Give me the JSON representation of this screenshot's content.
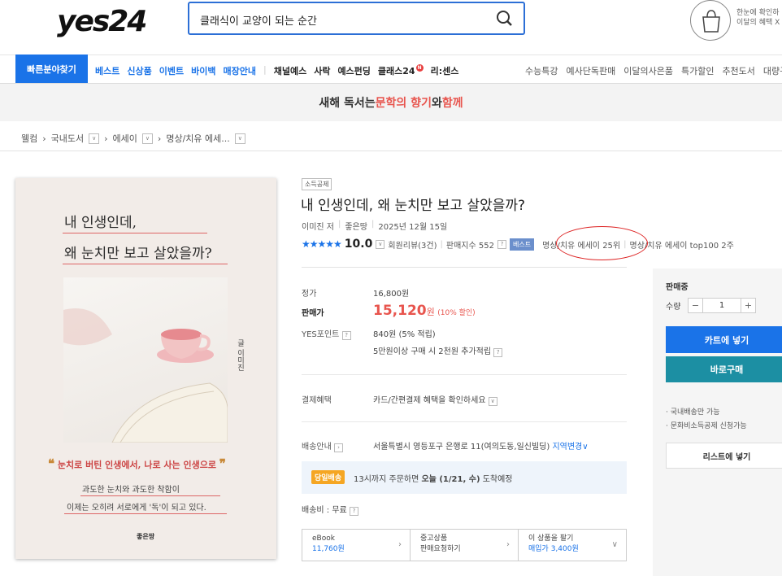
{
  "header": {
    "logo": "yes24",
    "search_value": "클래식이 교양이 되는 순간",
    "cart_note": "한눈에 확인하 이달의 혜택 X"
  },
  "nav": {
    "quick": "빠른분야찾기",
    "left_blue": [
      "베스트",
      "신상품",
      "이벤트",
      "바이백",
      "매장안내"
    ],
    "left_dark": [
      "채널예스",
      "사락",
      "예스펀딩",
      "클래스24",
      "리:센스"
    ],
    "badge": "N",
    "right": [
      "수능특강",
      "예사단독판매",
      "이달의사은품",
      "특가할인",
      "추천도서",
      "대량구"
    ]
  },
  "banner": {
    "prefix": "새해 독서는 ",
    "accent1": "문학의 향기",
    "mid": "와 ",
    "accent2": "함께"
  },
  "breadcrumb": [
    "웰컴",
    "국내도서",
    "에세이",
    "명상/치유 에세..."
  ],
  "cover": {
    "title1": "내 인생인데,",
    "title2": "왜 눈치만 보고 살았을까?",
    "author_vertical": "글 이미진",
    "quote": "눈치로 버틴 인생에서, 나로 사는 인생으로",
    "sub1": "과도한 눈치와 과도한 착함이",
    "sub2": "이제는 오히려 서로에게 '독'이 되고 있다.",
    "publisher": "좋은땅"
  },
  "product": {
    "tag": "소득공제",
    "title": "내 인생인데, 왜 눈치만 보고 살았을까?",
    "author": "이미진 저",
    "publisher": "좋은땅",
    "date": "2025년 12월 15일",
    "stars": "★★★★★",
    "score": "10.0",
    "reviews": "회원리뷰(3건)",
    "sales_index": "판매지수 552",
    "best_label": "베스트",
    "rank1": "명상/치유 에세이 25위",
    "rank2": "명상/치유 에세이 top100 2주"
  },
  "price": {
    "list_label": "정가",
    "list_value": "16,800원",
    "sale_label": "판매가",
    "sale_value": "15,120",
    "sale_unit": "원",
    "discount": "(10% 할인)",
    "points_label": "YES포인트",
    "points_value": "840원 (5% 적립)",
    "points_extra": "5만원이상 구매 시 2천원 추가적립"
  },
  "payment": {
    "label": "결제혜택",
    "value": "카드/간편결제 혜택을 확인하세요"
  },
  "delivery": {
    "label": "배송안내",
    "address": "서울특별시 영등포구 은행로 11(여의도동,일신빌딩)",
    "region_change": "지역변경",
    "today_badge": "당일배송",
    "today_text_pre": "13시까지 주문하면 ",
    "today_text_bold": "오늘 (1/21, 수)",
    "today_text_post": " 도착예정",
    "fee": "배송비 : 무료"
  },
  "bottom": {
    "ebook_label": "eBook",
    "ebook_price": "11,760원",
    "used_label": "중고상품",
    "used_action": "판매요청하기",
    "sell_label": "이 상품을 팔기",
    "sell_price": "매입가 3,400원"
  },
  "panel": {
    "status": "판매중",
    "qty_label": "수량",
    "qty_value": "1",
    "cart": "카트에 넣기",
    "buy": "바로구매",
    "note1": "· 국내배송만 가능",
    "note2": "· 문화비소득공제 신청가능",
    "list": "리스트에 넣기"
  }
}
